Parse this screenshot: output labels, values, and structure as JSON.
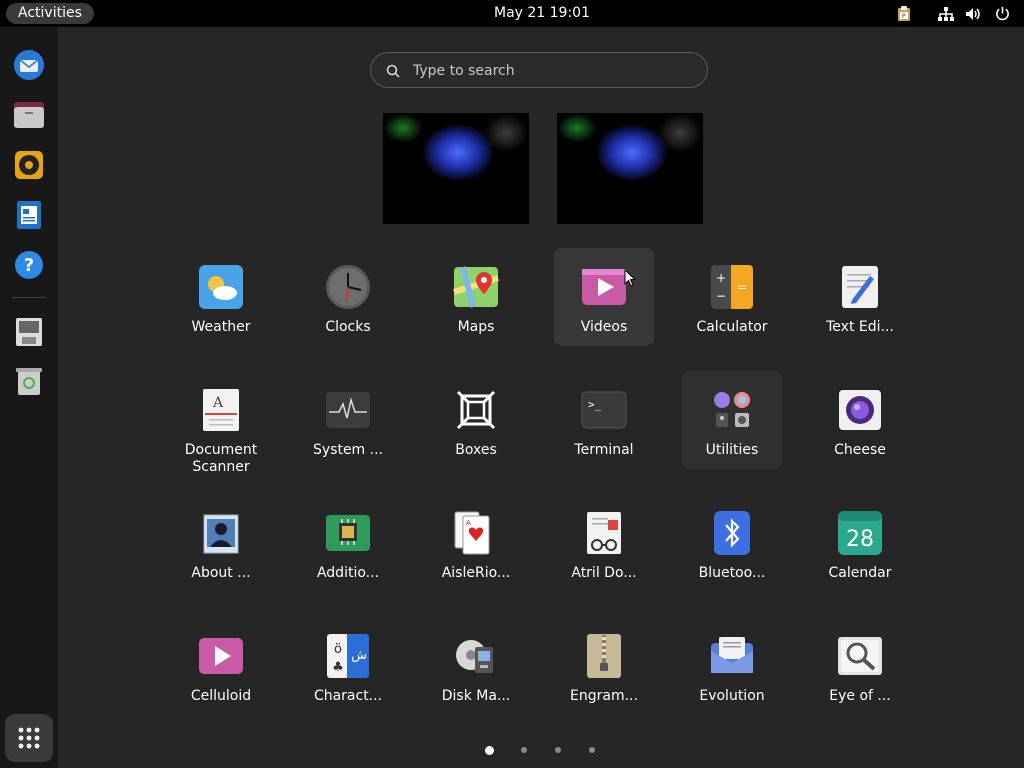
{
  "topbar": {
    "activities": "Activities",
    "clock": "May 21  19:01"
  },
  "search": {
    "placeholder": "Type to search"
  },
  "dock": {
    "items": [
      "thunderbird-icon",
      "files-icon",
      "rhythmbox-icon",
      "writer-icon",
      "help-icon",
      "save-drive-icon",
      "trash-icon"
    ],
    "show_apps": "app-grid-icon"
  },
  "apps": [
    {
      "label": "Weather",
      "icon": "weather-icon"
    },
    {
      "label": "Clocks",
      "icon": "clock-icon"
    },
    {
      "label": "Maps",
      "icon": "maps-icon"
    },
    {
      "label": "Videos",
      "icon": "videos-icon"
    },
    {
      "label": "Calculator",
      "icon": "calculator-icon"
    },
    {
      "label": "Text Edi...",
      "icon": "text-editor-icon"
    },
    {
      "label": "Document Scanner",
      "icon": "scanner-icon"
    },
    {
      "label": "System ...",
      "icon": "system-monitor-icon"
    },
    {
      "label": "Boxes",
      "icon": "boxes-icon"
    },
    {
      "label": "Terminal",
      "icon": "terminal-icon"
    },
    {
      "label": "Utilities",
      "icon": "utilities-folder-icon"
    },
    {
      "label": "Cheese",
      "icon": "cheese-icon"
    },
    {
      "label": "About ...",
      "icon": "about-icon"
    },
    {
      "label": "Additio...",
      "icon": "additional-drivers-icon"
    },
    {
      "label": "AisleRio...",
      "icon": "cards-icon"
    },
    {
      "label": "Atril Do...",
      "icon": "atril-icon"
    },
    {
      "label": "Bluetoo...",
      "icon": "bluetooth-icon"
    },
    {
      "label": "Calendar",
      "icon": "calendar-icon",
      "badge": "28"
    },
    {
      "label": "Celluloid",
      "icon": "celluloid-icon"
    },
    {
      "label": "Charact...",
      "icon": "characters-icon"
    },
    {
      "label": "Disk Ma...",
      "icon": "disk-manager-icon"
    },
    {
      "label": "Engram...",
      "icon": "archive-icon"
    },
    {
      "label": "Evolution",
      "icon": "evolution-icon"
    },
    {
      "label": "Eye of ...",
      "icon": "image-viewer-icon"
    }
  ],
  "pages": {
    "count": 4,
    "active": 1
  }
}
